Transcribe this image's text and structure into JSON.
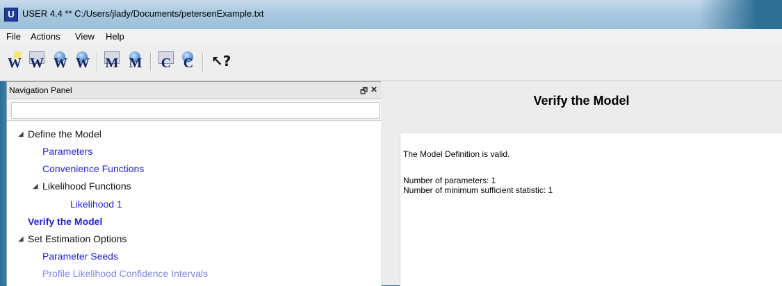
{
  "window": {
    "title": "USER 4.4 ** C:/Users/jlady/Documents/petersenExample.txt",
    "app_icon_letter": "U"
  },
  "menu": {
    "items": [
      "File",
      "Actions",
      "View",
      "Help"
    ]
  },
  "toolbar": {
    "buttons": [
      {
        "name": "new-w-button",
        "glyph": "W",
        "icon": "new-document-icon"
      },
      {
        "name": "open-w-button",
        "glyph": "W",
        "icon": "open-icon"
      },
      {
        "name": "save-w-button",
        "glyph": "W",
        "icon": "save-icon"
      },
      {
        "name": "save-as-w-button",
        "glyph": "W",
        "icon": "save-as-icon"
      },
      {
        "name": "open-m-button",
        "glyph": "M",
        "icon": "open-icon"
      },
      {
        "name": "save-m-button",
        "glyph": "M",
        "icon": "save-icon"
      },
      {
        "name": "open-c-button",
        "glyph": "C",
        "icon": "open-icon"
      },
      {
        "name": "save-c-button",
        "glyph": "C",
        "icon": "save-icon"
      },
      {
        "name": "context-help-button",
        "glyph": "?",
        "icon": "context-help-icon"
      }
    ]
  },
  "navigation_panel": {
    "title": "Navigation Panel",
    "float_icon": "restore-icon",
    "close_icon": "close-icon",
    "search_value": "",
    "tree": {
      "define_model": "Define the Model",
      "parameters": "Parameters",
      "convenience_functions": "Convenience Functions",
      "likelihood_functions": "Likelihood Functions",
      "likelihood_1": "Likelihood 1",
      "verify_model": "Verify the Model",
      "set_estimation_options": "Set Estimation Options",
      "parameter_seeds": "Parameter Seeds",
      "profile_likelihood": "Profile Likelihood Confidence Intervals"
    }
  },
  "content": {
    "heading": "Verify the Model",
    "lines": {
      "valid": "The Model Definition is valid.",
      "num_params": "Number of parameters: 1",
      "num_stats": "Number of minimum sufficient statistic: 1"
    }
  },
  "colors": {
    "link": "#2424d6",
    "active": "#2222d0",
    "faded_link": "#7f86e8"
  }
}
